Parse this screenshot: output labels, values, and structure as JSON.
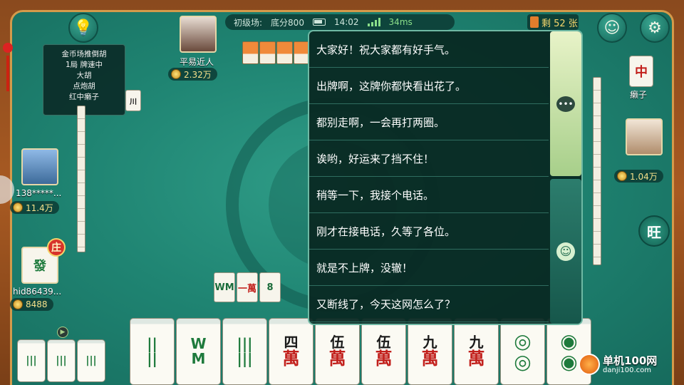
{
  "top_bar": {
    "room": "初级场:",
    "base_score": "底分800",
    "time": "14:02",
    "ping": "34ms"
  },
  "remaining": "剩 52 张",
  "rules": [
    "金币场推倒胡",
    "1局 牌速中",
    "大胡",
    "点炮胡",
    "红中癞子"
  ],
  "players": {
    "top": {
      "name": "平易近人",
      "coins": "2.32万"
    },
    "left": {
      "name": "138*****...",
      "coins": "11.4万"
    },
    "right": {
      "name": "",
      "coins": "1.04万"
    },
    "self": {
      "name": "hid86439...",
      "coins": "8488",
      "dealer_badge": "庄"
    }
  },
  "laizi": {
    "tile": "中",
    "label": "癞子"
  },
  "wang_button": "旺",
  "discards": [
    "WM",
    "一萬",
    "8"
  ],
  "hand_tiles": [
    {
      "top": "||",
      "bot": "||",
      "type": "bamboo"
    },
    {
      "top": "W",
      "bot": "M",
      "type": "bamboo"
    },
    {
      "top": "|||",
      "bot": "|||",
      "type": "bamboo"
    },
    {
      "top": "四",
      "bot": "萬",
      "type": "char"
    },
    {
      "top": "伍",
      "bot": "萬",
      "type": "char"
    },
    {
      "top": "伍",
      "bot": "萬",
      "type": "char"
    },
    {
      "top": "九",
      "bot": "萬",
      "type": "char"
    },
    {
      "top": "九",
      "bot": "萬",
      "type": "char"
    },
    {
      "top": "◎",
      "bot": "◎",
      "type": "circle"
    },
    {
      "top": "◉",
      "bot": "◉",
      "type": "circle"
    }
  ],
  "meld_tiles": [
    "|||",
    "|||",
    "|||"
  ],
  "quick_chat": [
    "大家好！祝大家都有好手气。",
    "出牌啊，这牌你都快看出花了。",
    "都别走啊，一会再打两圈。",
    "诶哟，好运来了挡不住！",
    "稍等一下，我接个电话。",
    "刚才在接电话，久等了各位。",
    "就是不上牌，没辙！",
    "又断线了，今天这网怎么了？"
  ],
  "watermark": {
    "name": "单机100网",
    "url": "danji100.com"
  },
  "colors": {
    "felt": "#1f8472",
    "panel": "#08282a",
    "accent": "#f4d46a"
  }
}
